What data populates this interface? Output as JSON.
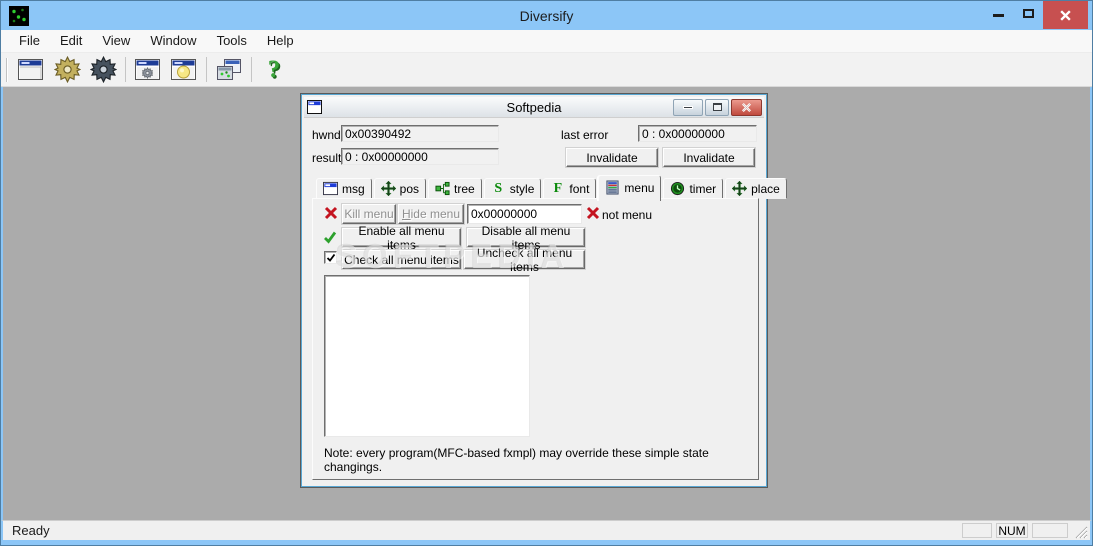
{
  "app": {
    "title": "Diversify"
  },
  "menubar": {
    "items": [
      "File",
      "Edit",
      "View",
      "Window",
      "Tools",
      "Help"
    ]
  },
  "toolbar": {
    "icons": [
      "new-window-icon",
      "gold-gear-icon",
      "dark-gear-icon",
      "window-gear-icon",
      "window-bulb-icon",
      "cascade-windows-icon",
      "help-icon"
    ],
    "help_glyph": "?"
  },
  "child": {
    "title": "Softpedia",
    "hwnd_label": "hwnd",
    "hwnd_value": "0x00390492",
    "result_label": "result",
    "result_value": "0 : 0x00000000",
    "last_error_label": "last error",
    "last_error_value": "0 : 0x00000000",
    "invalidate_1": "Invalidate",
    "invalidate_2": "Invalidate",
    "tabs": {
      "msg": "msg",
      "pos": "pos",
      "tree": "tree",
      "style": "style",
      "font": "font",
      "menu": "menu",
      "timer": "timer",
      "place": "place"
    },
    "active_tab": "menu",
    "menu_tab": {
      "kill_menu": "Kill menu",
      "hide_menu_accel": "H",
      "hide_menu_rest": "ide menu",
      "handle_value": "0x00000000",
      "not_menu_label": "not menu",
      "enable_all": "Enable all menu items",
      "disable_all": "Disable all menu items",
      "check_all": "Check all menu items",
      "uncheck_all": "Uncheck all menu items",
      "note": "Note: every program(MFC-based fxmpl) may override these simple state changings."
    },
    "watermark": "SOFTPEDIA"
  },
  "statusbar": {
    "ready": "Ready",
    "num": "NUM"
  },
  "colors": {
    "titlebar_blue": "#8cc6f7",
    "close_red": "#c75050",
    "mdi_gray": "#ababab",
    "accent_red": "#c41420",
    "accent_green": "#2da12d"
  }
}
